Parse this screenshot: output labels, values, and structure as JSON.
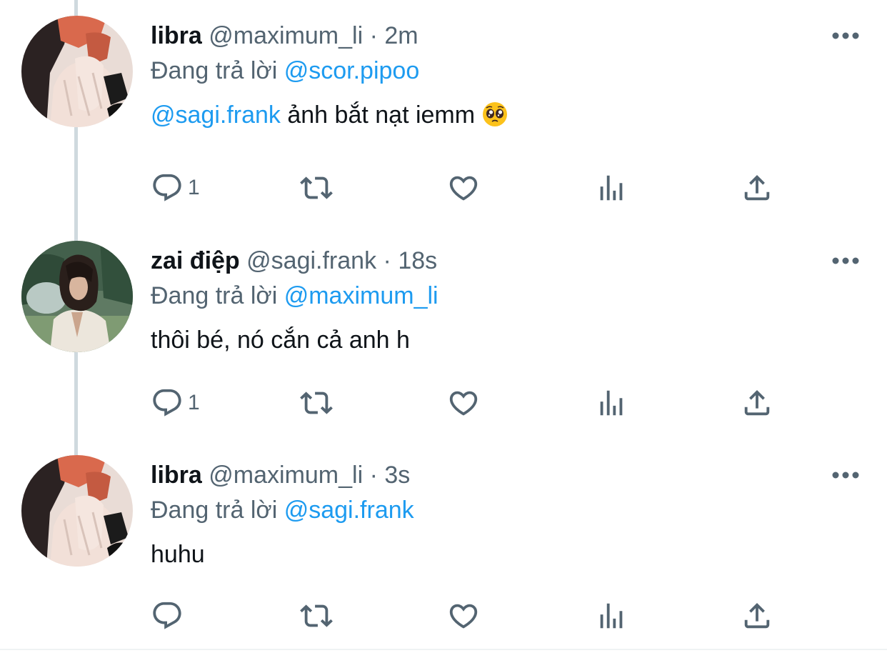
{
  "reply_prefix": "Đang trả lời",
  "tweets": [
    {
      "display_name": "libra",
      "handle": "@maximum_li",
      "separator": "·",
      "time": "2m",
      "replying_to": "@scor.pipoo",
      "mention": "@sagi.frank",
      "text": " ảnh bắt nạt iemm ",
      "emoji": "pleading-face-emoji",
      "reply_count": "1"
    },
    {
      "display_name": "zai điệp",
      "handle": "@sagi.frank",
      "separator": "·",
      "time": "18s",
      "replying_to": "@maximum_li",
      "text": "thôi bé, nó cắn cả anh h",
      "reply_count": "1"
    },
    {
      "display_name": "libra",
      "handle": "@maximum_li",
      "separator": "·",
      "time": "3s",
      "replying_to": "@sagi.frank",
      "text": "huhu",
      "reply_count": ""
    }
  ],
  "colors": {
    "link": "#1d9bf0",
    "secondary": "#536471",
    "primary": "#0f1419",
    "thread_line": "#cfd9de"
  },
  "icons": [
    "more-icon",
    "reply-icon",
    "retweet-icon",
    "like-icon",
    "views-icon",
    "share-icon"
  ]
}
